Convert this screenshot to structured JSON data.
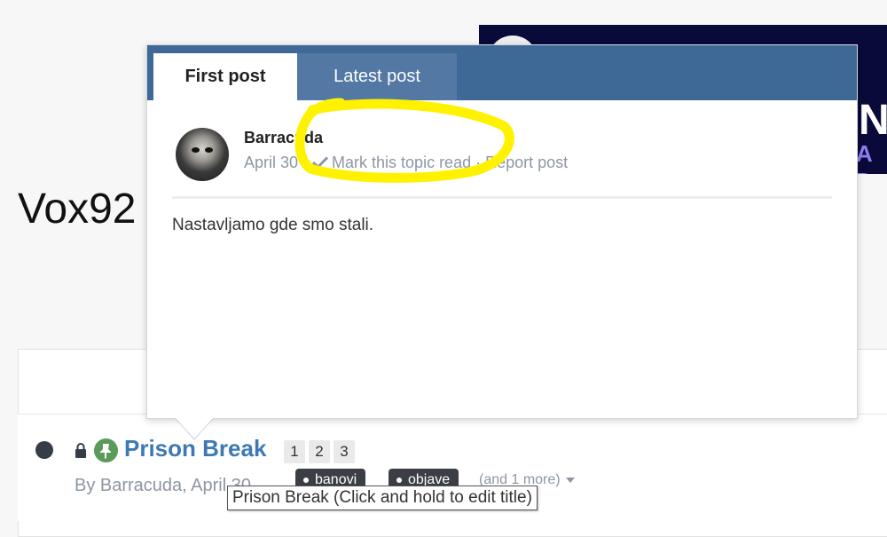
{
  "site": {
    "title": "Vox92"
  },
  "banner": {
    "letter": "N",
    "sub_text": "A D"
  },
  "popup": {
    "tabs": [
      {
        "label": "First post"
      },
      {
        "label": "Latest post"
      }
    ],
    "author": "Barracuda",
    "date": "April 30",
    "meta_sep": "·",
    "mark_read": "Mark this topic read",
    "report": "Report post",
    "body": "Nastavljamo gde smo stali."
  },
  "topic": {
    "title": "Prison Break",
    "pages": [
      "1",
      "2",
      "3"
    ],
    "byline": "By Barracuda, April 30",
    "tags": [
      "banovi",
      "objave"
    ],
    "more_tags": "(and 1 more)"
  },
  "tooltip": {
    "text": "Prison Break (Click and hold to edit title)"
  },
  "colors": {
    "accent": "#3e6896",
    "link": "#3d79b6",
    "highlight": "#fff200",
    "pin": "#5a9a5a"
  }
}
